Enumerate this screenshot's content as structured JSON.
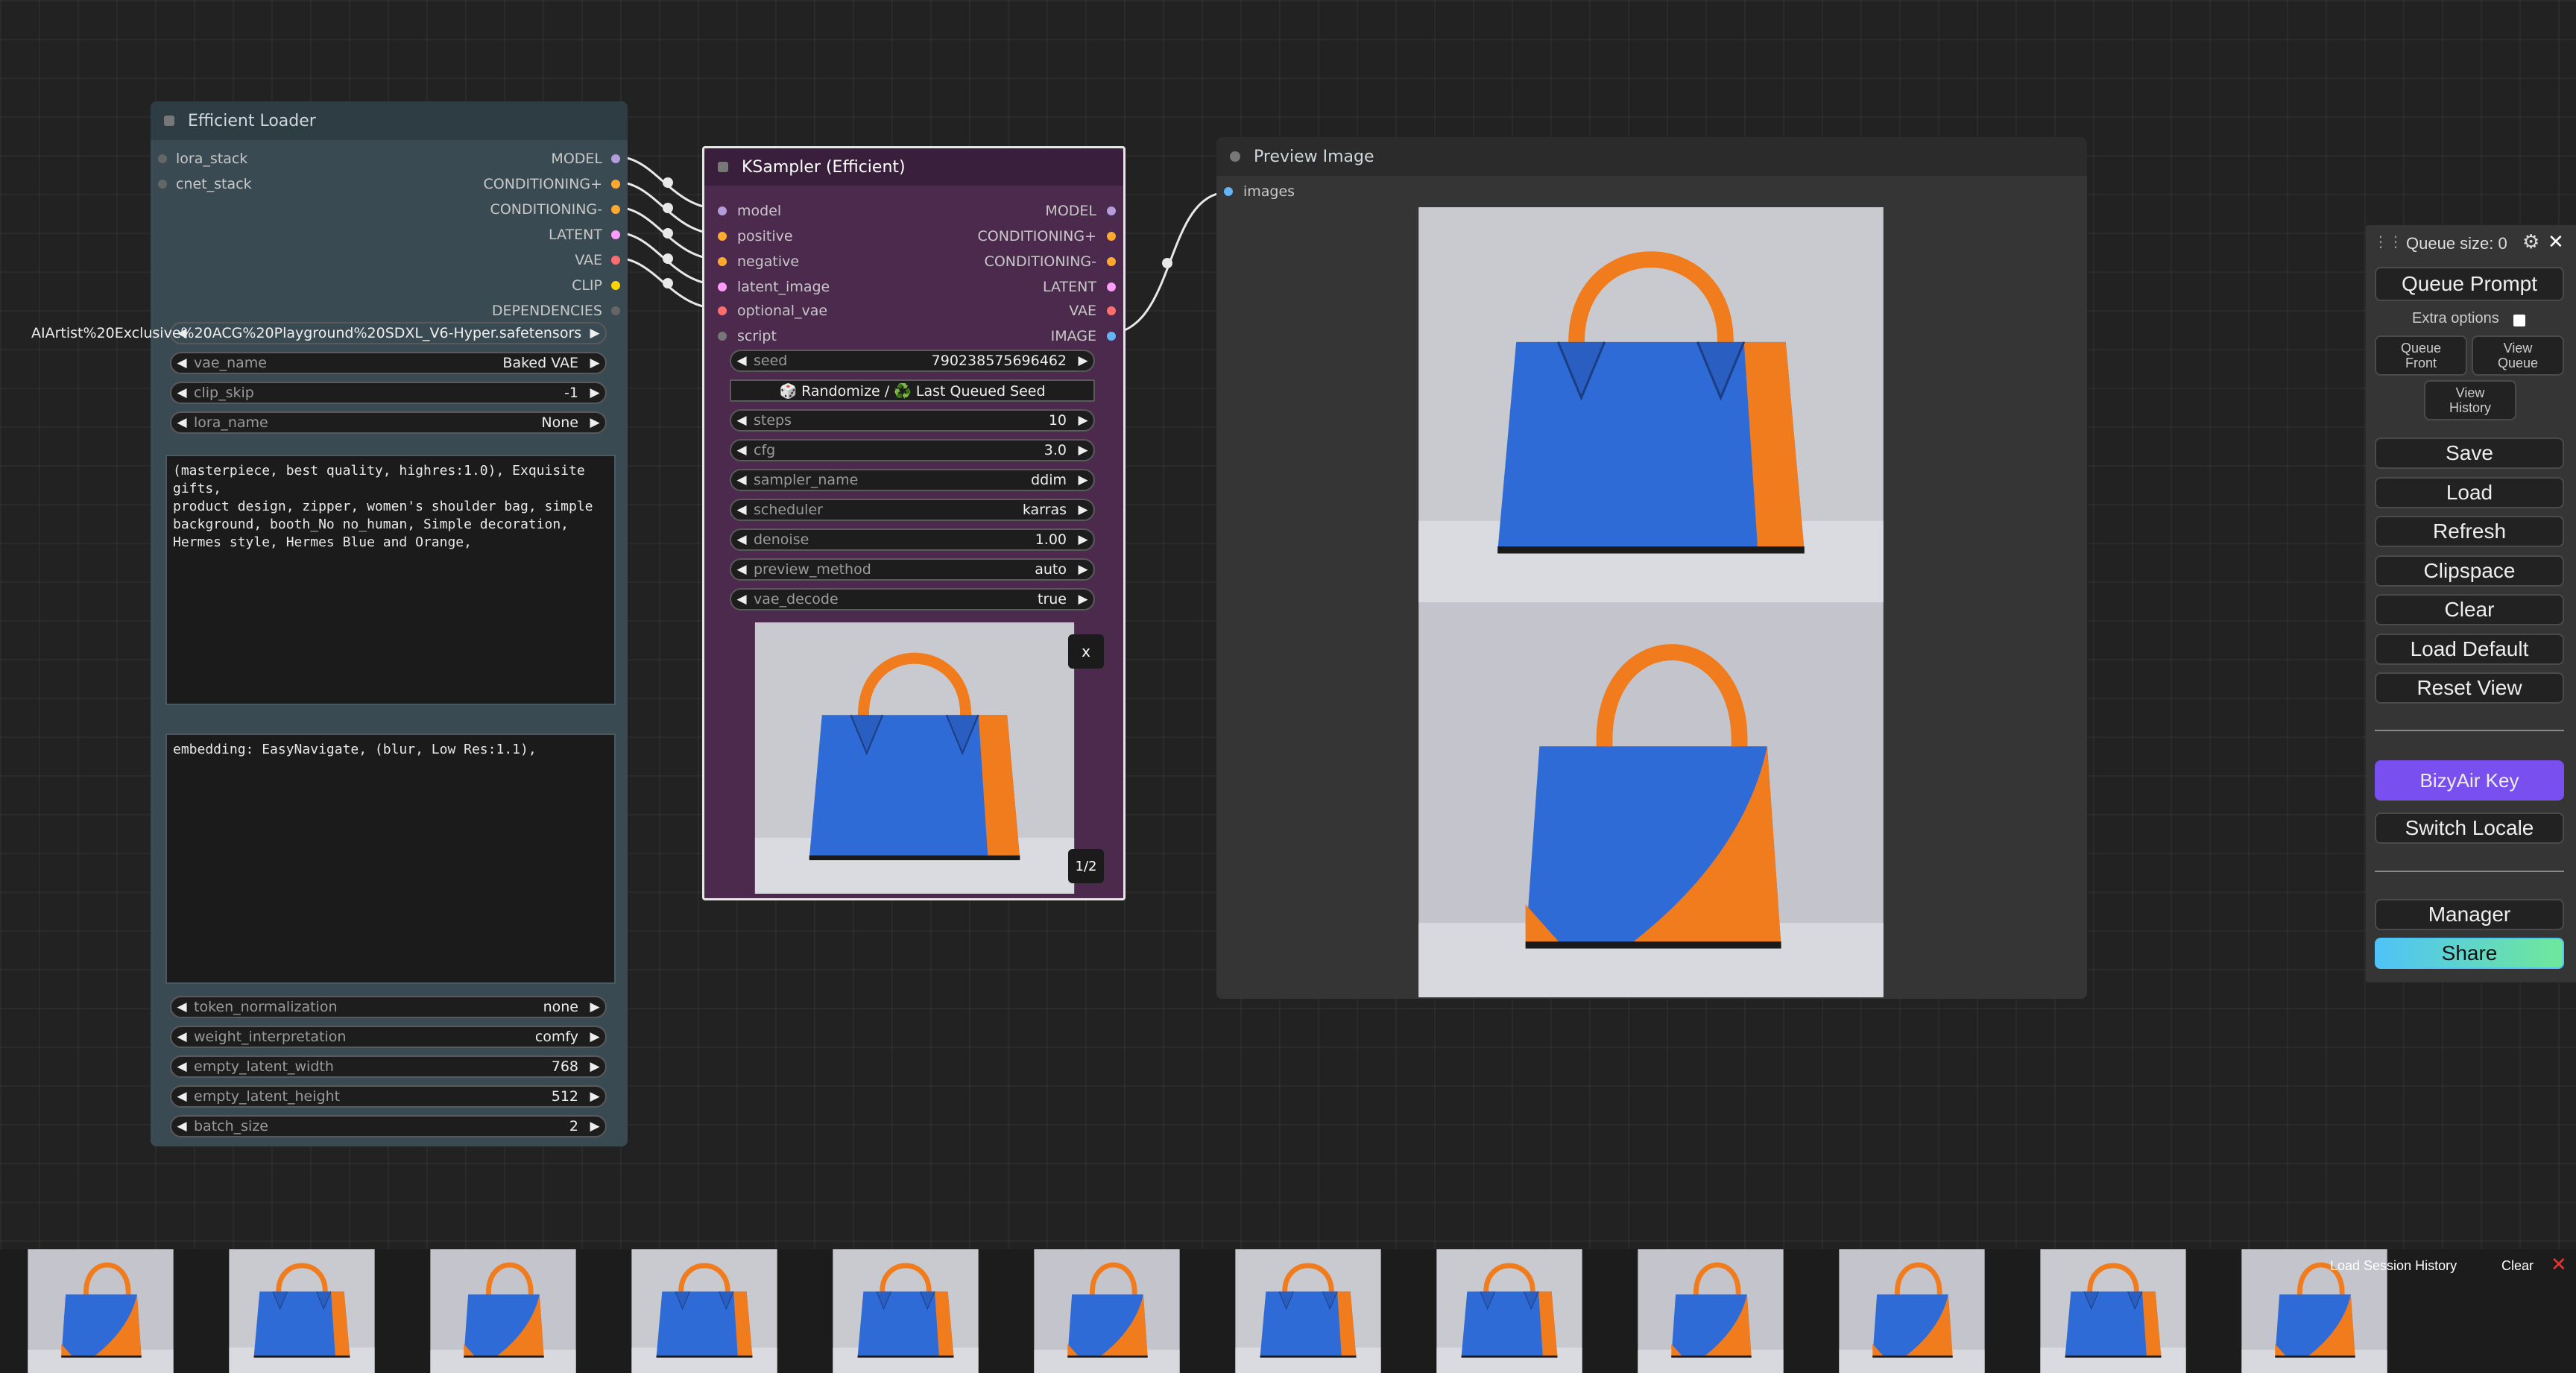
{
  "efficient_loader": {
    "title": "Efficient Loader",
    "inputs": [
      "lora_stack",
      "cnet_stack"
    ],
    "outputs": [
      "MODEL",
      "CONDITIONING+",
      "CONDITIONING-",
      "LATENT",
      "VAE",
      "CLIP",
      "DEPENDENCIES"
    ],
    "ckpt_name": "AIArtist%20Exclusive%20ACG%20Playground%20SDXL_V6-Hyper.safetensors",
    "vae_name": {
      "label": "vae_name",
      "value": "Baked VAE"
    },
    "clip_skip": {
      "label": "clip_skip",
      "value": "-1"
    },
    "lora_name": {
      "label": "lora_name",
      "value": "None"
    },
    "positive_prompt": "(masterpiece, best quality, highres:1.0), Exquisite gifts,\nproduct design, zipper, women's shoulder bag, simple\nbackground, booth_No no_human, Simple decoration,\nHermes style, Hermes Blue and Orange,",
    "negative_prompt": "embedding: EasyNavigate, (blur, Low Res:1.1),",
    "token_normalization": {
      "label": "token_normalization",
      "value": "none"
    },
    "weight_interpretation": {
      "label": "weight_interpretation",
      "value": "comfy"
    },
    "empty_latent_width": {
      "label": "empty_latent_width",
      "value": "768"
    },
    "empty_latent_height": {
      "label": "empty_latent_height",
      "value": "512"
    },
    "batch_size": {
      "label": "batch_size",
      "value": "2"
    }
  },
  "ksampler": {
    "title": "KSampler (Efficient)",
    "inputs": [
      "model",
      "positive",
      "negative",
      "latent_image",
      "optional_vae",
      "script"
    ],
    "outputs": [
      "MODEL",
      "CONDITIONING+",
      "CONDITIONING-",
      "LATENT",
      "VAE",
      "IMAGE"
    ],
    "seed": {
      "label": "seed",
      "value": "790238575696462"
    },
    "seed_button": "🎲 Randomize / ♻️ Last Queued Seed",
    "steps": {
      "label": "steps",
      "value": "10"
    },
    "cfg": {
      "label": "cfg",
      "value": "3.0"
    },
    "sampler_name": {
      "label": "sampler_name",
      "value": "ddim"
    },
    "scheduler": {
      "label": "scheduler",
      "value": "karras"
    },
    "denoise": {
      "label": "denoise",
      "value": "1.00"
    },
    "preview_method": {
      "label": "preview_method",
      "value": "auto"
    },
    "vae_decode": {
      "label": "vae_decode",
      "value": "true"
    },
    "preview_close": "x",
    "preview_counter": "1/2"
  },
  "preview_image": {
    "title": "Preview Image",
    "input": "images"
  },
  "side_menu": {
    "queue_size": "Queue size: 0",
    "queue_prompt": "Queue Prompt",
    "extra_options": "Extra options",
    "queue_front": "Queue\nFront",
    "view_queue": "View\nQueue",
    "view_history": "View\nHistory",
    "save": "Save",
    "load": "Load",
    "refresh": "Refresh",
    "clipspace": "Clipspace",
    "clear": "Clear",
    "load_default": "Load Default",
    "reset_view": "Reset View",
    "bizyair_key": "BizyAir Key",
    "switch_locale": "Switch Locale",
    "manager": "Manager",
    "share": "Share"
  },
  "history_bar": {
    "load_session_history": "Load Session History",
    "clear": "Clear",
    "close": "✕"
  },
  "colors": {
    "model": "#b39ddb",
    "conditioning": "#ffa931",
    "latent": "#ff9cf9",
    "vae": "#ff6e6e",
    "clip": "#ffd500",
    "image": "#64b5f6",
    "bag_blue": "#2f6bd6",
    "bag_orange": "#f07c1e"
  },
  "icons": [
    "gear-icon",
    "close-icon",
    "drag-handle-icon"
  ]
}
